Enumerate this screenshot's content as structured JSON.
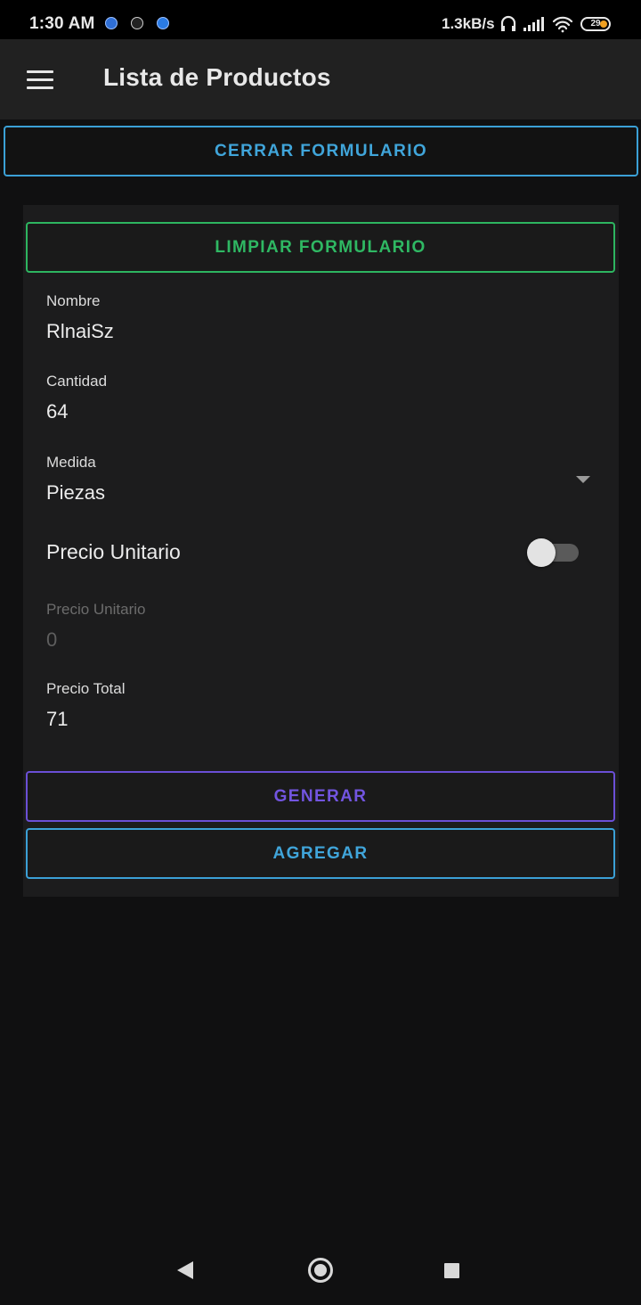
{
  "status_bar": {
    "time": "1:30 AM",
    "network_speed": "1.3kB/s",
    "battery_level": "29",
    "icons": [
      "notification-app-icon",
      "notification-app-icon",
      "notification-app-icon",
      "headphones-icon",
      "signal-icon",
      "wifi-icon",
      "battery-icon"
    ]
  },
  "app_bar": {
    "menu_icon": "hamburger-menu-icon",
    "title": "Lista de Productos"
  },
  "buttons": {
    "close_form": "CERRAR FORMULARIO",
    "clear_form": "LIMPIAR FORMULARIO",
    "generate": "GENERAR",
    "add": "AGREGAR"
  },
  "form": {
    "nombre": {
      "label": "Nombre",
      "value": "RlnaiSz"
    },
    "cantidad": {
      "label": "Cantidad",
      "value": "64"
    },
    "medida": {
      "label": "Medida",
      "value": "Piezas"
    },
    "precio_unitario_toggle": {
      "label": "Precio Unitario",
      "enabled": false
    },
    "precio_unitario": {
      "label": "Precio Unitario",
      "value": "0",
      "disabled": true
    },
    "precio_total": {
      "label": "Precio Total",
      "value": "71"
    }
  },
  "colors": {
    "background": "#101011",
    "app_bar": "#212121",
    "card": "#1c1c1d",
    "blue_accent": "#40a5da",
    "green_accent": "#2fb863",
    "purple_accent": "#7255e0"
  },
  "nav_bar": {
    "icons": [
      "back-icon",
      "home-icon",
      "recents-icon"
    ]
  }
}
